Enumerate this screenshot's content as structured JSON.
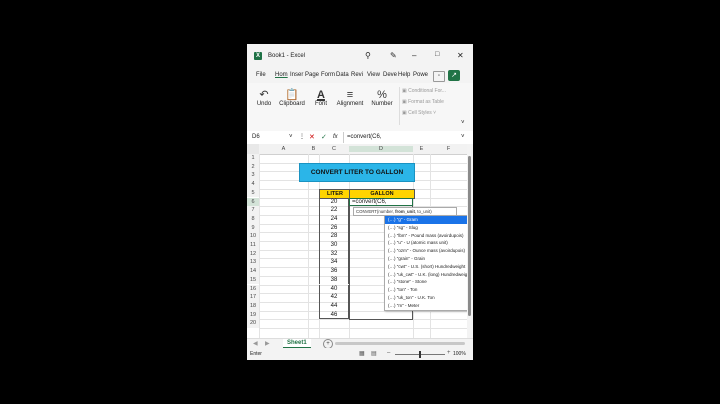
{
  "window": {
    "title": "Book1 - Excel",
    "app_icon_color": "#1e7145"
  },
  "menu": {
    "items": [
      "File",
      "Hom",
      "Inser",
      "Page",
      "Form",
      "Data",
      "Revi",
      "View",
      "Deve",
      "Help",
      "Powe"
    ]
  },
  "ribbon": {
    "undo": "Undo",
    "clipboard": "Clipboard",
    "font": "Font",
    "alignment": "Alignment",
    "number": "Number",
    "styles": [
      "Conditional For...",
      "Format as Table",
      "Cell Styles"
    ]
  },
  "formula_bar": {
    "name_box": "D6",
    "fx": "fx",
    "formula": "=convert(C6,"
  },
  "sheet": {
    "columns": [
      "A",
      "B",
      "C",
      "D",
      "E",
      "F"
    ],
    "rows": [
      "1",
      "2",
      "3",
      "4",
      "5",
      "6",
      "7",
      "8",
      "9",
      "10",
      "11",
      "12",
      "13",
      "14",
      "15",
      "16",
      "17",
      "18",
      "19",
      "20"
    ],
    "title": "CONVERT LITER TO GALLON",
    "headers": {
      "liter": "LITER",
      "gallon": "GALLON"
    },
    "liters": [
      "20",
      "22",
      "24",
      "26",
      "28",
      "30",
      "32",
      "34",
      "36",
      "38",
      "40",
      "42",
      "44",
      "46"
    ],
    "edit_cell": "=convert(C6,",
    "tooltip": "CONVERT(number, from_unit, to_unit)",
    "tooltip_parts": {
      "fn": "CONVERT(number, ",
      "bold": "from_unit",
      "rest": ", to_unit)"
    }
  },
  "autocomplete": [
    "\"g\" - Gram",
    "\"sg\" - Slug",
    "\"lbm\" - Pound mass (avoirdupois)",
    "\"u\" - U (atomic mass unit)",
    "\"ozm\" - Ounce mass (avoirdupois)",
    "\"grain\" - Grain",
    "\"cwt\" - U.S. (short) Hundredweight",
    "\"uk_cwt\" - U.K. (long) Hundredweight",
    "\"stone\" - Stone",
    "\"ton\" - Ton",
    "\"uk_ton\" - U.K. Ton",
    "\"m\" - Meter"
  ],
  "tabs": {
    "sheet": "Sheet1",
    "add": "+"
  },
  "status": {
    "mode": "Enter",
    "zoom": "100%"
  },
  "colors": {
    "title_fill": "#2bb5e8",
    "header_fill": "#ffd400",
    "accent": "#217346",
    "selection": "#1a73e8"
  }
}
